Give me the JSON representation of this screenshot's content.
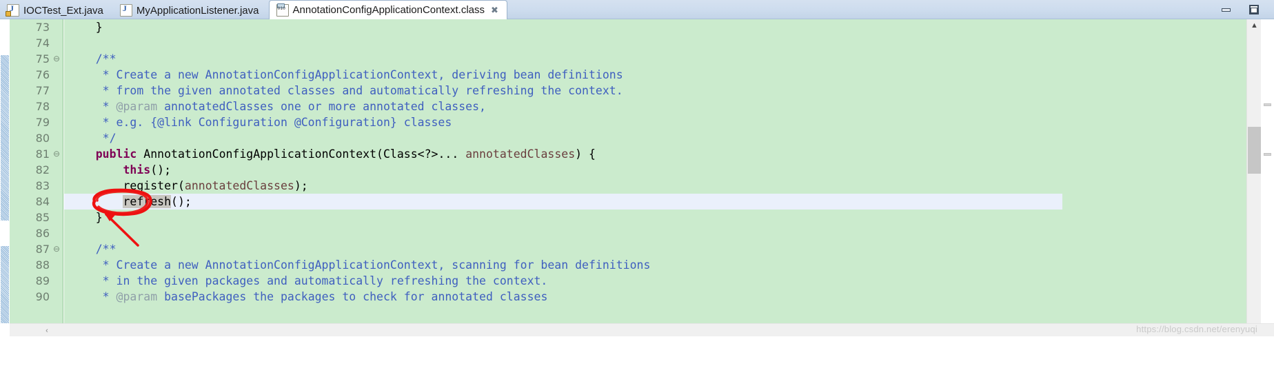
{
  "window": {
    "minimize_label": "Minimize",
    "maximize_label": "Maximize"
  },
  "tabs": [
    {
      "label": "IOCTest_Ext.java",
      "icon": "java-file-icon",
      "active": false,
      "closable": false
    },
    {
      "label": "MyApplicationListener.java",
      "icon": "java-file-icon",
      "active": false,
      "closable": false
    },
    {
      "label": "AnnotationConfigApplicationContext.class",
      "icon": "class-file-icon",
      "active": true,
      "closable": true,
      "close_glyph": "✖"
    }
  ],
  "editor": {
    "scroll": {
      "up_arrow_glyph": "▲",
      "left_arrow_glyph": "‹"
    },
    "highlighted_line": 84,
    "selected_token": "refresh",
    "lines": [
      {
        "num": "73",
        "fold": "",
        "segments": [
          {
            "t": "    }",
            "c": "c-plain"
          }
        ]
      },
      {
        "num": "74",
        "fold": "",
        "segments": [
          {
            "t": "",
            "c": "c-plain"
          }
        ]
      },
      {
        "num": "75",
        "fold": "⊖",
        "segments": [
          {
            "t": "    /**",
            "c": "c-doc"
          }
        ]
      },
      {
        "num": "76",
        "fold": "",
        "segments": [
          {
            "t": "     * Create a new AnnotationConfigApplicationContext, deriving bean definitions",
            "c": "c-doc"
          }
        ]
      },
      {
        "num": "77",
        "fold": "",
        "segments": [
          {
            "t": "     * from the given annotated classes and automatically refreshing the context.",
            "c": "c-doc"
          }
        ]
      },
      {
        "num": "78",
        "fold": "",
        "segments": [
          {
            "t": "     * ",
            "c": "c-doc"
          },
          {
            "t": "@param",
            "c": "c-tag"
          },
          {
            "t": " annotatedClasses one or more annotated classes,",
            "c": "c-doc"
          }
        ]
      },
      {
        "num": "79",
        "fold": "",
        "segments": [
          {
            "t": "     * e.g. {@link Configuration @Configuration} classes",
            "c": "c-doc"
          }
        ]
      },
      {
        "num": "80",
        "fold": "",
        "segments": [
          {
            "t": "     */",
            "c": "c-doc"
          }
        ]
      },
      {
        "num": "81",
        "fold": "⊖",
        "segments": [
          {
            "t": "    ",
            "c": "c-plain"
          },
          {
            "t": "public",
            "c": "c-kw"
          },
          {
            "t": " AnnotationConfigApplicationContext(Class<?>... ",
            "c": "c-plain"
          },
          {
            "t": "annotatedClasses",
            "c": "c-param"
          },
          {
            "t": ") {",
            "c": "c-plain"
          }
        ]
      },
      {
        "num": "82",
        "fold": "",
        "segments": [
          {
            "t": "        ",
            "c": "c-plain"
          },
          {
            "t": "this",
            "c": "c-kw"
          },
          {
            "t": "();",
            "c": "c-plain"
          }
        ]
      },
      {
        "num": "83",
        "fold": "",
        "segments": [
          {
            "t": "        register(",
            "c": "c-plain"
          },
          {
            "t": "annotatedClasses",
            "c": "c-param"
          },
          {
            "t": ");",
            "c": "c-plain"
          }
        ]
      },
      {
        "num": "84",
        "fold": "",
        "segments": [
          {
            "t": "        ",
            "c": "c-plain"
          },
          {
            "t": "refresh",
            "c": "c-plain sel-bg"
          },
          {
            "t": "();",
            "c": "c-plain"
          }
        ]
      },
      {
        "num": "85",
        "fold": "",
        "segments": [
          {
            "t": "    }",
            "c": "c-plain"
          }
        ]
      },
      {
        "num": "86",
        "fold": "",
        "segments": [
          {
            "t": "",
            "c": "c-plain"
          }
        ]
      },
      {
        "num": "87",
        "fold": "⊖",
        "segments": [
          {
            "t": "    /**",
            "c": "c-doc"
          }
        ]
      },
      {
        "num": "88",
        "fold": "",
        "segments": [
          {
            "t": "     * Create a new AnnotationConfigApplicationContext, scanning for bean definitions",
            "c": "c-doc"
          }
        ]
      },
      {
        "num": "89",
        "fold": "",
        "segments": [
          {
            "t": "     * in the given packages and automatically refreshing the context.",
            "c": "c-doc"
          }
        ]
      },
      {
        "num": "90",
        "fold": "",
        "segments": [
          {
            "t": "     * ",
            "c": "c-doc"
          },
          {
            "t": "@param",
            "c": "c-tag"
          },
          {
            "t": " basePackages the packages to check for annotated classes",
            "c": "c-doc"
          }
        ]
      }
    ]
  },
  "annotations": {
    "ellipse_color": "#ee1111",
    "arrow_color": "#ee1111",
    "target_token": "refresh"
  },
  "watermark": {
    "text": "https://blog.csdn.net/erenyuqi"
  },
  "colors": {
    "code_background": "#cbebcd",
    "gutter_background": "#cbebcd",
    "highlight_line": "#eaf0fb",
    "selection": "#c8c6c0",
    "javadoc": "#3f5fbf",
    "keyword": "#7f0055",
    "param": "#6a3e3e",
    "doc_tag": "#8f9fa8",
    "tabbar": "#cddcee",
    "annotation_red": "#ee1111"
  }
}
